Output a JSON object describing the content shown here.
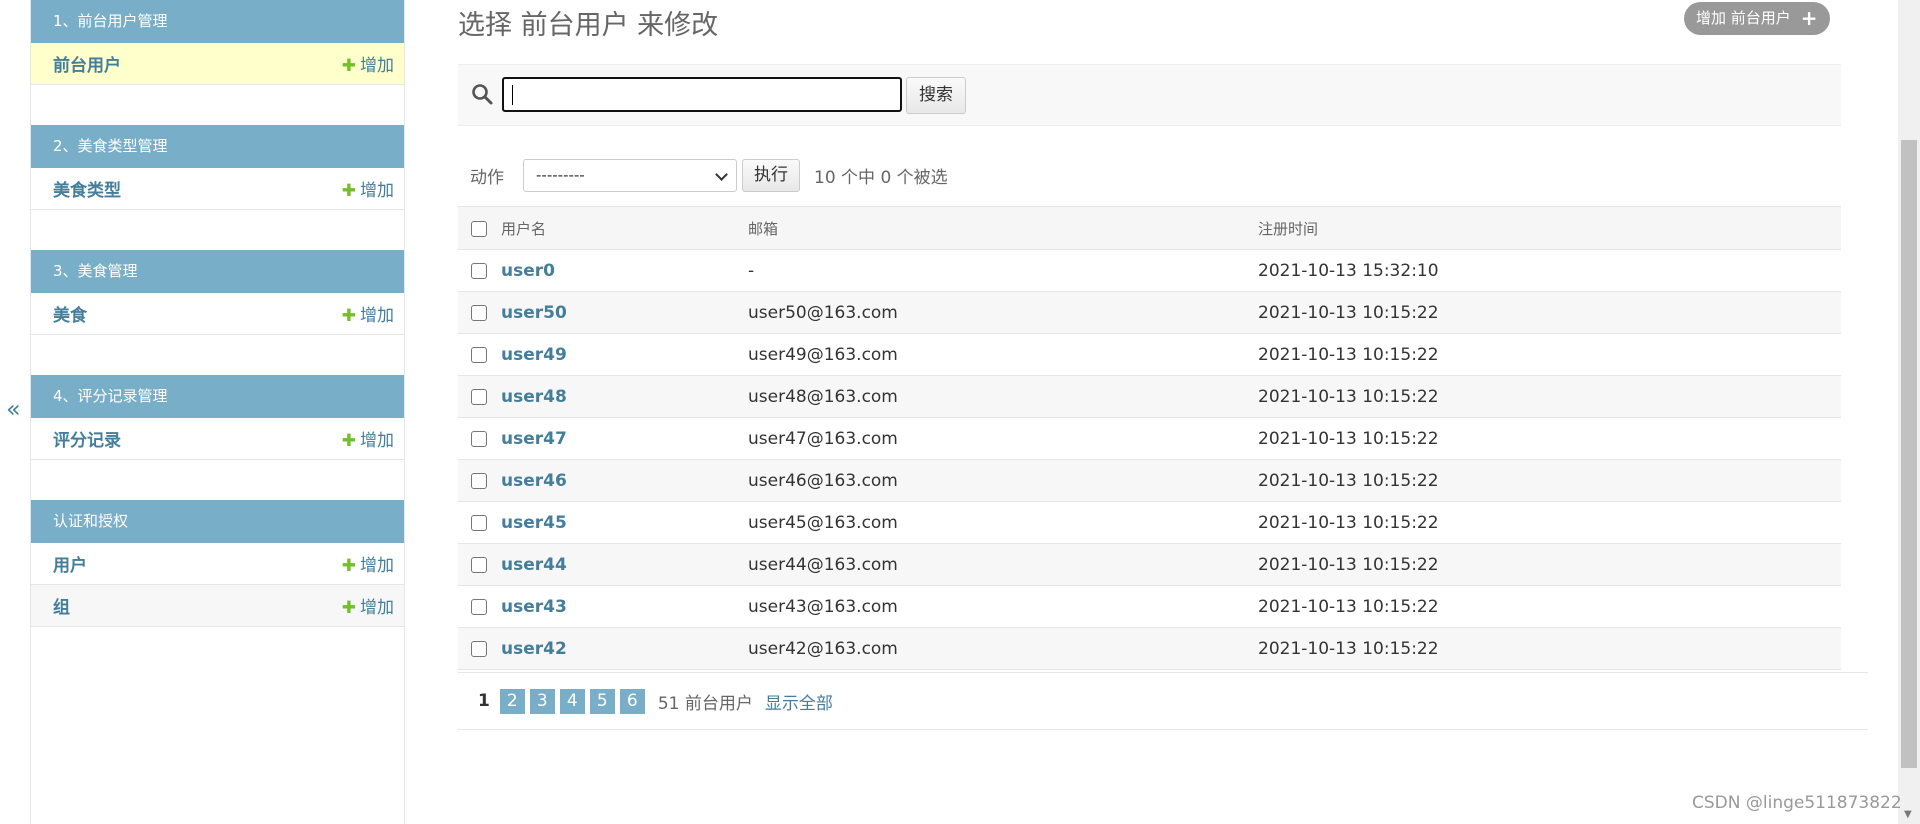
{
  "sidebar": {
    "modules": [
      {
        "caption": "1、前台用户管理",
        "rows": [
          {
            "label": "前台用户",
            "add": "增加"
          }
        ]
      },
      {
        "caption": "2、美食类型管理",
        "rows": [
          {
            "label": "美食类型",
            "add": "增加"
          }
        ]
      },
      {
        "caption": "3、美食管理",
        "rows": [
          {
            "label": "美食",
            "add": "增加"
          }
        ]
      },
      {
        "caption": "4、评分记录管理",
        "rows": [
          {
            "label": "评分记录",
            "add": "增加"
          }
        ]
      },
      {
        "caption": "认证和授权",
        "rows": [
          {
            "label": "用户",
            "add": "增加"
          },
          {
            "label": "组",
            "add": "增加"
          }
        ]
      }
    ],
    "toggle": "«"
  },
  "header": {
    "title": "选择 前台用户 来修改",
    "add_button": "增加 前台用户",
    "add_icon": "+"
  },
  "search": {
    "value": "",
    "button": "搜索"
  },
  "actions": {
    "label": "动作",
    "selected": "---------",
    "run": "执行",
    "selection_info": "10 个中 0 个被选"
  },
  "table": {
    "headers": [
      "用户名",
      "邮箱",
      "注册时间"
    ],
    "rows": [
      {
        "username": "user0",
        "email": "-",
        "registered": "2021-10-13 15:32:10"
      },
      {
        "username": "user50",
        "email": "user50@163.com",
        "registered": "2021-10-13 10:15:22"
      },
      {
        "username": "user49",
        "email": "user49@163.com",
        "registered": "2021-10-13 10:15:22"
      },
      {
        "username": "user48",
        "email": "user48@163.com",
        "registered": "2021-10-13 10:15:22"
      },
      {
        "username": "user47",
        "email": "user47@163.com",
        "registered": "2021-10-13 10:15:22"
      },
      {
        "username": "user46",
        "email": "user46@163.com",
        "registered": "2021-10-13 10:15:22"
      },
      {
        "username": "user45",
        "email": "user45@163.com",
        "registered": "2021-10-13 10:15:22"
      },
      {
        "username": "user44",
        "email": "user44@163.com",
        "registered": "2021-10-13 10:15:22"
      },
      {
        "username": "user43",
        "email": "user43@163.com",
        "registered": "2021-10-13 10:15:22"
      },
      {
        "username": "user42",
        "email": "user42@163.com",
        "registered": "2021-10-13 10:15:22"
      }
    ]
  },
  "paginator": {
    "current": "1",
    "pages": [
      "2",
      "3",
      "4",
      "5",
      "6"
    ],
    "result_count": "51 前台用户",
    "show_all": "显示全部"
  },
  "watermark": "CSDN @linge511873822",
  "colors": {
    "module_caption": "#79aec8",
    "link": "#447e9b",
    "add_plus": "#70bf2b",
    "current_row": "#ffffcc"
  }
}
